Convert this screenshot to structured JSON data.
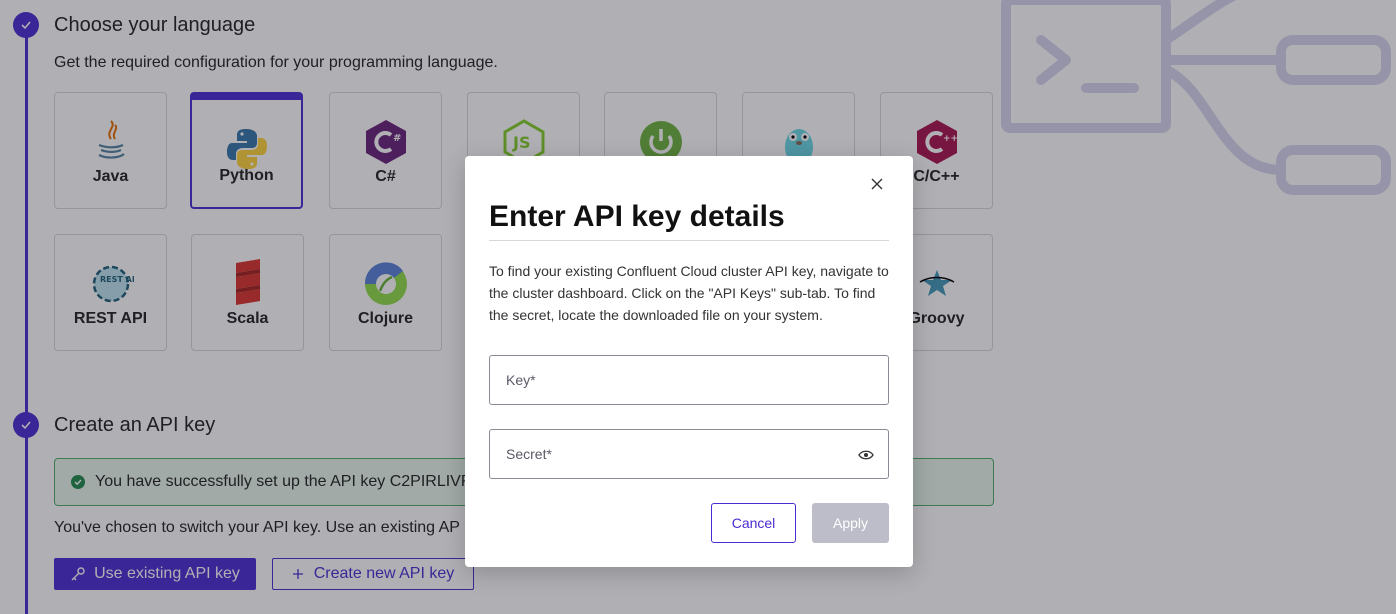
{
  "steps": {
    "language": {
      "title": "Choose your language",
      "subtitle": "Get the required configuration for your programming language."
    },
    "api_key": {
      "title": "Create an API key",
      "success_text": "You have successfully set up the API key C2PIRLIVR",
      "switch_text": "You've chosen to switch your API key. Use an existing AP",
      "use_existing_label": "Use existing API key",
      "create_new_label": "Create new API key"
    }
  },
  "languages": [
    {
      "label": "Java",
      "icon": "java-icon"
    },
    {
      "label": "Python",
      "icon": "python-icon",
      "selected": true
    },
    {
      "label": "C#",
      "icon": "csharp-icon"
    },
    {
      "label": "",
      "icon": "nodejs-icon"
    },
    {
      "label": "",
      "icon": "spring-icon"
    },
    {
      "label": "",
      "icon": "go-gopher-icon"
    },
    {
      "label": "C/C++",
      "icon": "cpp-icon"
    },
    {
      "label": "REST API",
      "icon": "rest-api-icon"
    },
    {
      "label": "Scala",
      "icon": "scala-icon"
    },
    {
      "label": "Clojure",
      "icon": "clojure-icon"
    },
    {
      "label": "Groovy",
      "icon": "groovy-icon"
    }
  ],
  "modal": {
    "title": "Enter API key details",
    "description": "To find your existing Confluent Cloud cluster API key, navigate to the cluster dashboard. Click on the \"API Keys\" sub-tab. To find the secret, locate the downloaded file on your system.",
    "key_placeholder": "Key*",
    "key_value": "",
    "secret_placeholder": "Secret*",
    "secret_value": "",
    "cancel_label": "Cancel",
    "apply_label": "Apply"
  },
  "colors": {
    "accent": "#4b2bd1",
    "success_border": "#4fae6e",
    "success_bg": "#e8f6ec",
    "disabled_button": "#bdbdc9"
  },
  "rest_icon_text": "REST API"
}
